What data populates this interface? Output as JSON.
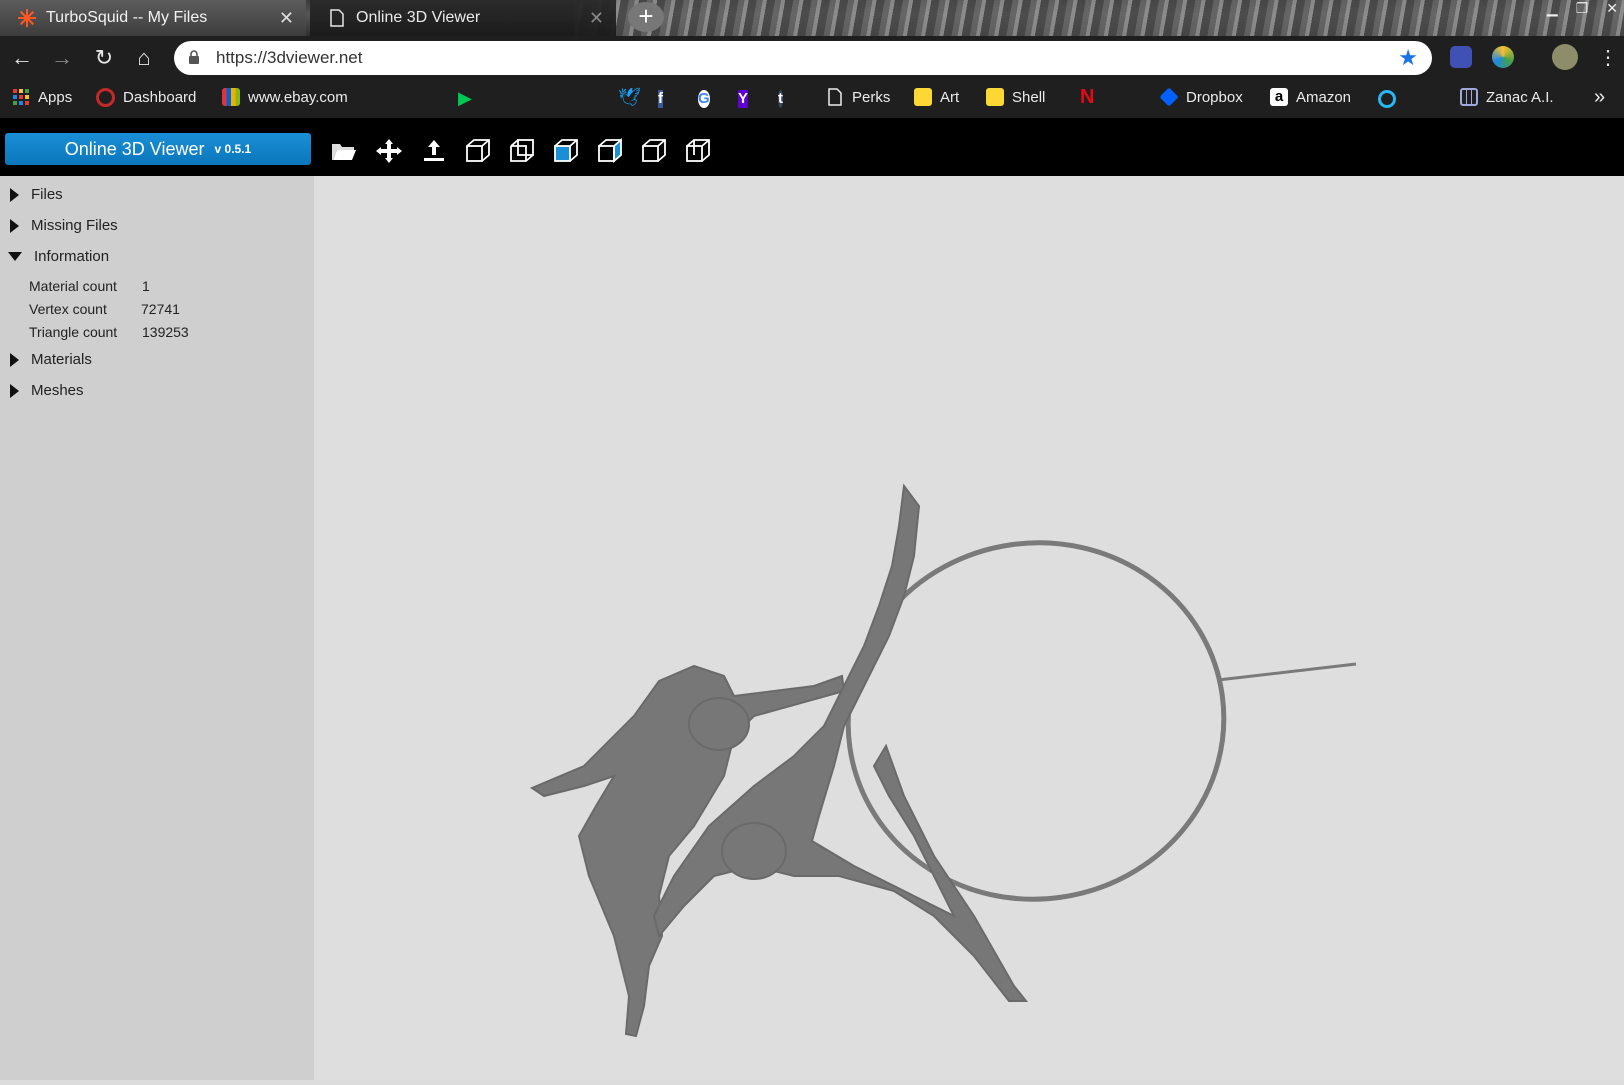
{
  "browser": {
    "tabs": [
      {
        "title": "TurboSquid -- My Files",
        "icon": "turbosquid-icon",
        "active": false
      },
      {
        "title": "Online 3D Viewer",
        "icon": "page-icon",
        "active": true
      }
    ],
    "url": "https://3dviewer.net"
  },
  "bookmarks": [
    {
      "label": "Apps",
      "icon": "apps-grid-icon",
      "color": "#e53935"
    },
    {
      "label": "Dashboard",
      "icon": "dashboard-icon",
      "color": "#c62828"
    },
    {
      "label": "www.ebay.com",
      "icon": "ebay-icon",
      "color": "#f5af02"
    },
    {
      "label": "",
      "icon": "shop-icon",
      "color": "#e64a19"
    },
    {
      "label": "",
      "icon": "circle-icon",
      "color": "#7b1fa2"
    },
    {
      "label": "",
      "icon": "play-store-icon",
      "color": "#00c853"
    },
    {
      "label": "",
      "icon": "paypal-icon",
      "color": "#1565c0"
    },
    {
      "label": "",
      "icon": "instagram-icon",
      "color": "#d81b60"
    },
    {
      "label": "",
      "icon": "youtube-icon",
      "color": "#ff0000"
    },
    {
      "label": "",
      "icon": "twitter-icon",
      "color": "#1da1f2"
    },
    {
      "label": "",
      "icon": "facebook-icon",
      "color": "#3b5998"
    },
    {
      "label": "",
      "icon": "google-icon",
      "color": "#4285f4"
    },
    {
      "label": "",
      "icon": "yahoo-icon",
      "color": "#6001d2"
    },
    {
      "label": "",
      "icon": "tumblr-icon",
      "color": "#35465c"
    },
    {
      "label": "Perks",
      "icon": "page-icon",
      "color": "#eeeeee"
    },
    {
      "label": "Art",
      "icon": "folder-icon",
      "color": "#fdd835"
    },
    {
      "label": "Shell",
      "icon": "folder-icon",
      "color": "#fdd835"
    },
    {
      "label": "",
      "icon": "netflix-icon",
      "color": "#e50914"
    },
    {
      "label": "",
      "icon": "link-icon",
      "color": "#5c6bc0"
    },
    {
      "label": "Dropbox",
      "icon": "dropbox-icon",
      "color": "#0061ff"
    },
    {
      "label": "Amazon",
      "icon": "amazon-icon",
      "color": "#ffffff"
    },
    {
      "label": "",
      "icon": "search-q-icon",
      "color": "#29b6f6"
    },
    {
      "label": "Zanac A.I.",
      "icon": "grid-icon",
      "color": "#9fa8da"
    }
  ],
  "app": {
    "title": "Online 3D Viewer",
    "version": "v 0.5.1",
    "accent": "#0f82c8"
  },
  "panel": {
    "sections": [
      {
        "label": "Files",
        "expanded": false
      },
      {
        "label": "Missing Files",
        "expanded": false
      },
      {
        "label": "Information",
        "expanded": true
      },
      {
        "label": "Materials",
        "expanded": false
      },
      {
        "label": "Meshes",
        "expanded": false
      }
    ],
    "info": [
      {
        "label": "Material count",
        "value": "1"
      },
      {
        "label": "Vertex count",
        "value": "72741"
      },
      {
        "label": "Triangle count",
        "value": "139253"
      }
    ]
  }
}
